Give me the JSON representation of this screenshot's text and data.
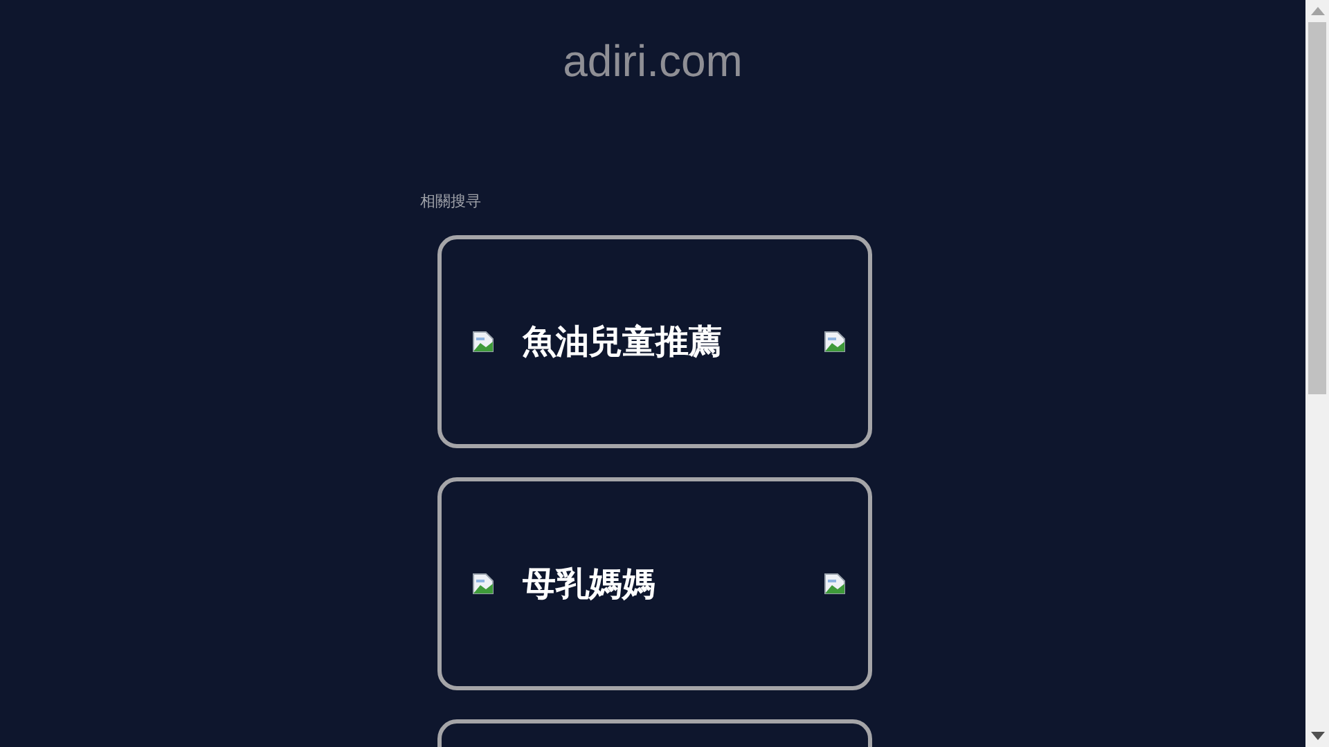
{
  "site_title": "adiri.com",
  "section_label": "相關搜寻",
  "cards": [
    {
      "kind": "link",
      "label": "魚油兒童推薦"
    },
    {
      "kind": "link",
      "label": "母乳媽媽"
    },
    {
      "kind": "cut"
    }
  ]
}
